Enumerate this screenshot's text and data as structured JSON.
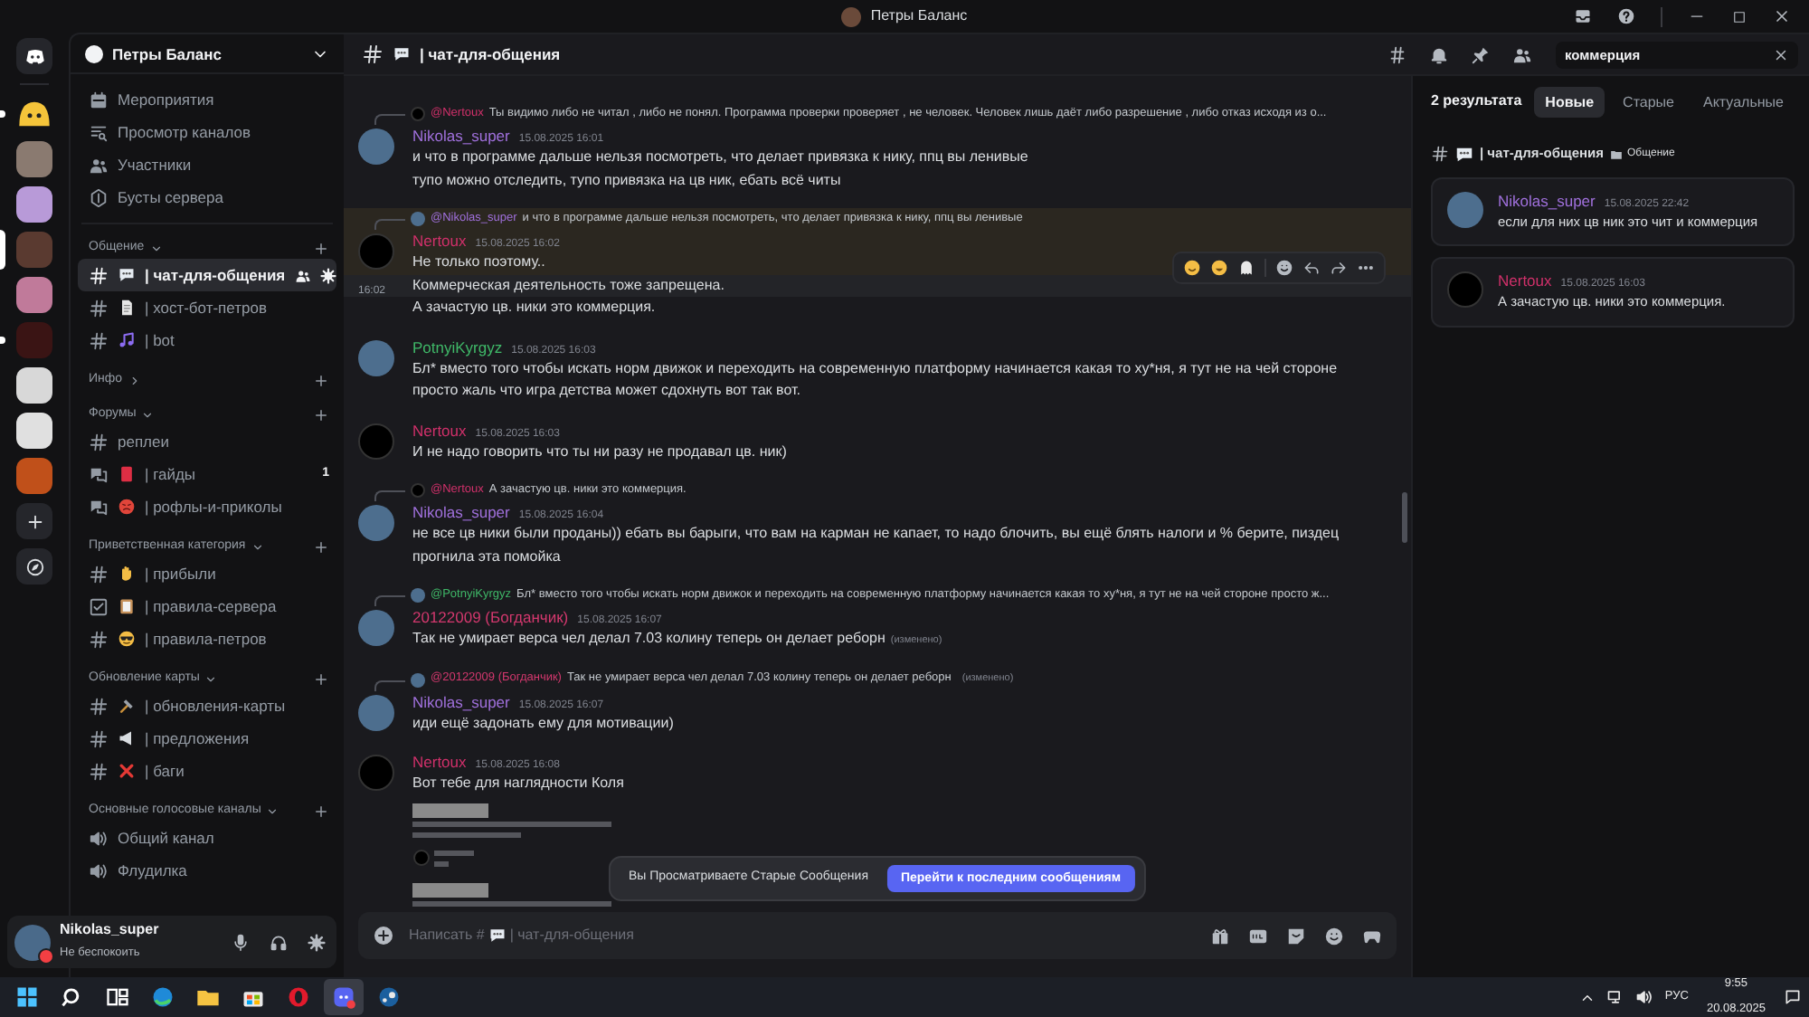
{
  "title_bar": {
    "title": "Петры Баланс"
  },
  "servers": [
    {
      "kind": "home",
      "selected": false,
      "unread": false
    },
    {
      "kind": "emoji",
      "selected": false,
      "unread": true
    },
    {
      "kind": "image",
      "color": "#8a7a70",
      "selected": false,
      "unread": false
    },
    {
      "kind": "image",
      "color": "#b89ad8",
      "selected": false,
      "unread": false
    },
    {
      "kind": "image",
      "color": "#5a3a30",
      "selected": true,
      "unread": false
    },
    {
      "kind": "image",
      "color": "#c07a9a",
      "selected": false,
      "unread": false
    },
    {
      "kind": "image",
      "color": "#3a1414",
      "selected": false,
      "unread": true
    },
    {
      "kind": "image",
      "color": "#d8d8d8",
      "selected": false,
      "unread": false
    },
    {
      "kind": "image",
      "color": "#e0e0e0",
      "selected": false,
      "unread": false
    },
    {
      "kind": "image",
      "color": "#c0501a",
      "selected": false,
      "unread": false
    },
    {
      "kind": "add",
      "selected": false,
      "unread": false
    },
    {
      "kind": "discover",
      "selected": false,
      "unread": false
    }
  ],
  "sidebar": {
    "server_name": "Петры Баланс",
    "nav_items": [
      {
        "kind": "events",
        "label": "Мероприятия"
      },
      {
        "kind": "browse",
        "label": "Просмотр каналов"
      },
      {
        "kind": "members",
        "label": "Участники"
      },
      {
        "kind": "boosts",
        "label": "Бусты сервера"
      }
    ],
    "categories": [
      {
        "name": "Общение",
        "expanded": true,
        "channels": [
          {
            "kind": "text",
            "emoji": {
              "kind": "chat"
            },
            "name": "| чат-для-общения",
            "selected": true
          },
          {
            "kind": "text",
            "emoji": {
              "kind": "page"
            },
            "name": "| хост-бот-петров",
            "selected": false
          },
          {
            "kind": "text",
            "emoji": {
              "kind": "note"
            },
            "name": "| bot",
            "selected": false
          }
        ]
      },
      {
        "name": "Инфо",
        "expanded": false
      },
      {
        "name": "Форумы",
        "expanded": true,
        "channels": [
          {
            "kind": "text",
            "name": "реплеи",
            "selected": false
          },
          {
            "kind": "forum",
            "emoji": {
              "kind": "book"
            },
            "name": "| гайды",
            "selected": false,
            "badge": "1"
          },
          {
            "kind": "forum",
            "emoji": {
              "kind": "angry"
            },
            "name": "| рофлы-и-приколы",
            "selected": false
          }
        ]
      },
      {
        "name": "Приветственная категория",
        "expanded": true,
        "channels": [
          {
            "kind": "text",
            "emoji": {
              "kind": "hand"
            },
            "name": "| прибыли",
            "selected": false
          },
          {
            "kind": "rules",
            "emoji": {
              "kind": "clipboard"
            },
            "name": "| правила-сервера",
            "selected": false
          },
          {
            "kind": "text",
            "emoji": {
              "kind": "cool"
            },
            "name": "| правила-петров",
            "selected": false
          }
        ]
      },
      {
        "name": "Обновление карты",
        "expanded": true,
        "channels": [
          {
            "kind": "text",
            "emoji": {
              "kind": "hammer"
            },
            "name": "| обновления-карты",
            "selected": false
          },
          {
            "kind": "text",
            "emoji": {
              "kind": "megaphone"
            },
            "name": "| предложения",
            "selected": false
          },
          {
            "kind": "text",
            "emoji": {
              "kind": "cross"
            },
            "name": "| баги",
            "selected": false
          }
        ]
      },
      {
        "name": "Основные голосовые каналы",
        "expanded": true,
        "channels": [
          {
            "kind": "voice",
            "name": "Общий канал",
            "selected": false
          },
          {
            "kind": "voice",
            "name": "Флудилка",
            "selected": false
          }
        ]
      }
    ],
    "user": {
      "name": "Nikolas_super",
      "status": "Не беспокоить"
    }
  },
  "header": {
    "emoji": {
      "kind": "chat"
    },
    "channel": "| чат-для-общения",
    "search": {
      "value": "коммерция"
    }
  },
  "messages": [
    {
      "author": "Nikolas_super",
      "color": "#a070dc",
      "avatar": {
        "kind": "photo"
      },
      "time": "15.08.2025 16:01",
      "mentioned": false,
      "reply": {
        "author": "@Nertoux",
        "color": "#d0306a",
        "avatar": {
          "kind": "logo"
        },
        "text": "Ты видимо либо не читал , либо не понял.  Программа проверки проверяет , не человек. Человек лишь даёт либо разрешение , либо отказ исходя из о..."
      },
      "lines": [
        {
          "text": "и что в программе дальше нельзя посмотреть, что делает привязка к нику, ппц вы ленивые",
          "hovered": false
        },
        {
          "text": "тупо можно отследить, тупо привязка на цв ник, ебать всё читы",
          "hovered": false
        }
      ]
    },
    {
      "author": "Nertoux",
      "color": "#d0306a",
      "avatar": {
        "kind": "logo"
      },
      "time": "15.08.2025 16:02",
      "mentioned": true,
      "reply": {
        "author": "@Nikolas_super",
        "color": "#a070dc",
        "avatar": {
          "kind": "photo"
        },
        "text": "и что в программе дальше нельзя посмотреть, что делает привязка к нику, ппц вы ленивые"
      },
      "lines": [
        {
          "text": "Не только поэтому..",
          "hovered": false
        },
        {
          "text": "Коммерческая деятельность тоже запрещена.",
          "time": "16:02",
          "hovered": true
        },
        {
          "text": "А зачастую цв. ники это коммерция.",
          "hovered": false
        }
      ]
    },
    {
      "author": "PotnyiKyrgyz",
      "color": "#3fb868",
      "avatar": {
        "kind": "photo"
      },
      "time": "15.08.2025 16:03",
      "mentioned": false,
      "lines": [
        {
          "text": "Бл* вместо того чтобы искать норм движок и переходить на современную платформу начинается какая то ху*ня, я тут не на чей стороне просто жаль что игра детства может сдохнуть вот так вот.",
          "hovered": false
        }
      ]
    },
    {
      "author": "Nertoux",
      "color": "#d0306a",
      "avatar": {
        "kind": "logo"
      },
      "time": "15.08.2025 16:03",
      "mentioned": false,
      "lines": [
        {
          "text": "И не надо говорить что ты ни разу не продавал цв. ник)",
          "hovered": false
        }
      ]
    },
    {
      "author": "Nikolas_super",
      "color": "#a070dc",
      "avatar": {
        "kind": "photo"
      },
      "time": "15.08.2025 16:04",
      "mentioned": false,
      "reply": {
        "author": "@Nertoux",
        "color": "#d0306a",
        "avatar": {
          "kind": "logo"
        },
        "text": "А зачастую цв. ники это коммерция."
      },
      "lines": [
        {
          "text": "не все цв ники были проданы)) ебать вы барыги, что вам на карман не капает, то надо блочить, вы ещё блять налоги и % берите, пиздец прогнила эта помойка",
          "hovered": false
        }
      ]
    },
    {
      "author": "20122009 (Богданчик)",
      "color": "#d4386e",
      "avatar": {
        "kind": "photo"
      },
      "time": "15.08.2025 16:07",
      "mentioned": false,
      "reply": {
        "author": "@PotnyiKyrgyz",
        "color": "#3fb868",
        "avatar": {
          "kind": "photo"
        },
        "text": "Бл* вместо того чтобы искать норм движок и переходить на современную платформу начинается какая то ху*ня, я тут не на чей стороне просто ж..."
      },
      "lines": [
        {
          "text": "Так не умирает верса чел делал 7.03 колину теперь он делает реборн",
          "edited": "(изменено)",
          "hovered": false
        }
      ]
    },
    {
      "author": "Nikolas_super",
      "color": "#a070dc",
      "avatar": {
        "kind": "photo"
      },
      "time": "15.08.2025 16:07",
      "mentioned": false,
      "reply": {
        "author": "@20122009 (Богданчик)",
        "color": "#d4386e",
        "avatar": {
          "kind": "photo"
        },
        "text": "Так не умирает верса чел делал 7.03 колину теперь он делает реборн",
        "edited": "(изменено)"
      },
      "lines": [
        {
          "text": "иди ещё задонать ему для мотивации)",
          "hovered": false
        }
      ]
    },
    {
      "author": "Nertoux",
      "color": "#d0306a",
      "avatar": {
        "kind": "logo"
      },
      "time": "15.08.2025 16:08",
      "mentioned": false,
      "attachment": true,
      "lines": [
        {
          "text": "Вот тебе для наглядности Коля",
          "hovered": false
        }
      ]
    }
  ],
  "old_messages_bar": {
    "text": "Вы Просматриваете Старые Сообщения",
    "button": "Перейти к последним сообщениям"
  },
  "composer": {
    "placeholder": "Написать #",
    "emoji": {
      "kind": "chat"
    },
    "channel": "| чат-для-общения"
  },
  "search_panel": {
    "count": "2 результата",
    "tabs": [
      {
        "label": "Новые",
        "selected": true
      },
      {
        "label": "Старые",
        "selected": false
      },
      {
        "label": "Актуальные",
        "selected": false
      }
    ],
    "group": {
      "emoji": {
        "kind": "chat"
      },
      "channel": "| чат-для-общения",
      "category": "Общение"
    },
    "results": [
      {
        "author": "Nikolas_super",
        "color": "#a070dc",
        "avatar": {
          "kind": "photo"
        },
        "time": "15.08.2025 22:42",
        "text": "если для них цв ник это чит и коммерция"
      },
      {
        "author": "Nertoux",
        "color": "#d0306a",
        "avatar": {
          "kind": "logo"
        },
        "time": "15.08.2025 16:03",
        "text": "А зачастую цв. ники это коммерция."
      }
    ]
  },
  "taskbar": {
    "apps": [
      {
        "kind": "start",
        "active": false
      },
      {
        "kind": "search",
        "active": false
      },
      {
        "kind": "taskview",
        "active": false
      },
      {
        "kind": "edge",
        "active": false
      },
      {
        "kind": "explorer",
        "active": false
      },
      {
        "kind": "store",
        "active": false
      },
      {
        "kind": "opera",
        "active": false
      },
      {
        "kind": "discord",
        "active": true
      },
      {
        "kind": "steam",
        "active": false
      }
    ],
    "language": "РУС",
    "time": "9:55",
    "date": "20.08.2025"
  }
}
